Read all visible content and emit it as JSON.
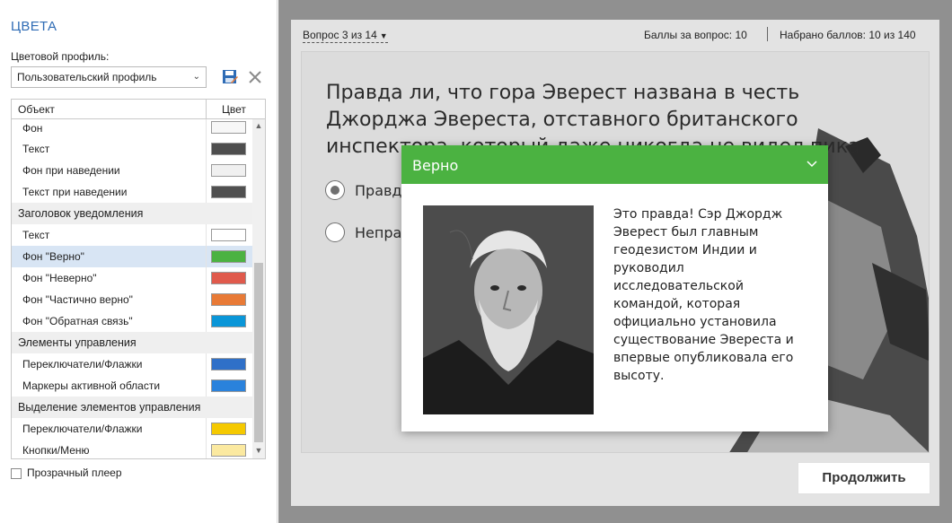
{
  "panel": {
    "title": "ЦВЕТА",
    "profile_label": "Цветовой профиль:",
    "profile_value": "Пользовательский профиль",
    "table": {
      "col_object": "Объект",
      "col_color": "Цвет",
      "rows": [
        {
          "label": "Фон",
          "color": "#f7f7f7"
        },
        {
          "label": "Текст",
          "color": "#4e4e4e"
        },
        {
          "label": "Фон при наведении",
          "color": "#f0f0f0"
        },
        {
          "label": "Текст при наведении",
          "color": "#505050"
        },
        {
          "group": "Заголовок уведомления"
        },
        {
          "label": "Текст",
          "color": "#ffffff"
        },
        {
          "label": "Фон \"Верно\"",
          "color": "#4bb241",
          "selected": true
        },
        {
          "label": "Фон \"Неверно\"",
          "color": "#e05a4c"
        },
        {
          "label": "Фон \"Частично верно\"",
          "color": "#e87a36"
        },
        {
          "label": "Фон \"Обратная связь\"",
          "color": "#0a96d8"
        },
        {
          "group": "Элементы управления"
        },
        {
          "label": "Переключатели/Флажки",
          "color": "#2f70c8"
        },
        {
          "label": "Маркеры активной области",
          "color": "#2a82dc"
        },
        {
          "group": "Выделение элементов управления"
        },
        {
          "label": "Переключатели/Флажки",
          "color": "#f5c900"
        },
        {
          "label": "Кнопки/Меню",
          "color": "#fbe9a0"
        }
      ]
    },
    "transparent_label": "Прозрачный плеер"
  },
  "player": {
    "question_nav": "Вопрос 3 из 14",
    "points_per_question": "Баллы за вопрос: 10",
    "points_total": "Набрано баллов: 10 из 140",
    "question_text": "Правда ли, что гора Эверест названа в честь Джорджа Эвереста, отставного британского инспектора, который даже никогда не видел пика",
    "options": [
      "Правда",
      "Неправда"
    ],
    "continue_label": "Продолжить"
  },
  "popup": {
    "title": "Верно",
    "text": "Это правда! Сэр Джордж Эверест был главным геодезистом Индии и руководил исследовательской командой, которая официально установила существование Эвереста и впервые опубликовала его высоту.",
    "header_color": "#4bb241"
  }
}
